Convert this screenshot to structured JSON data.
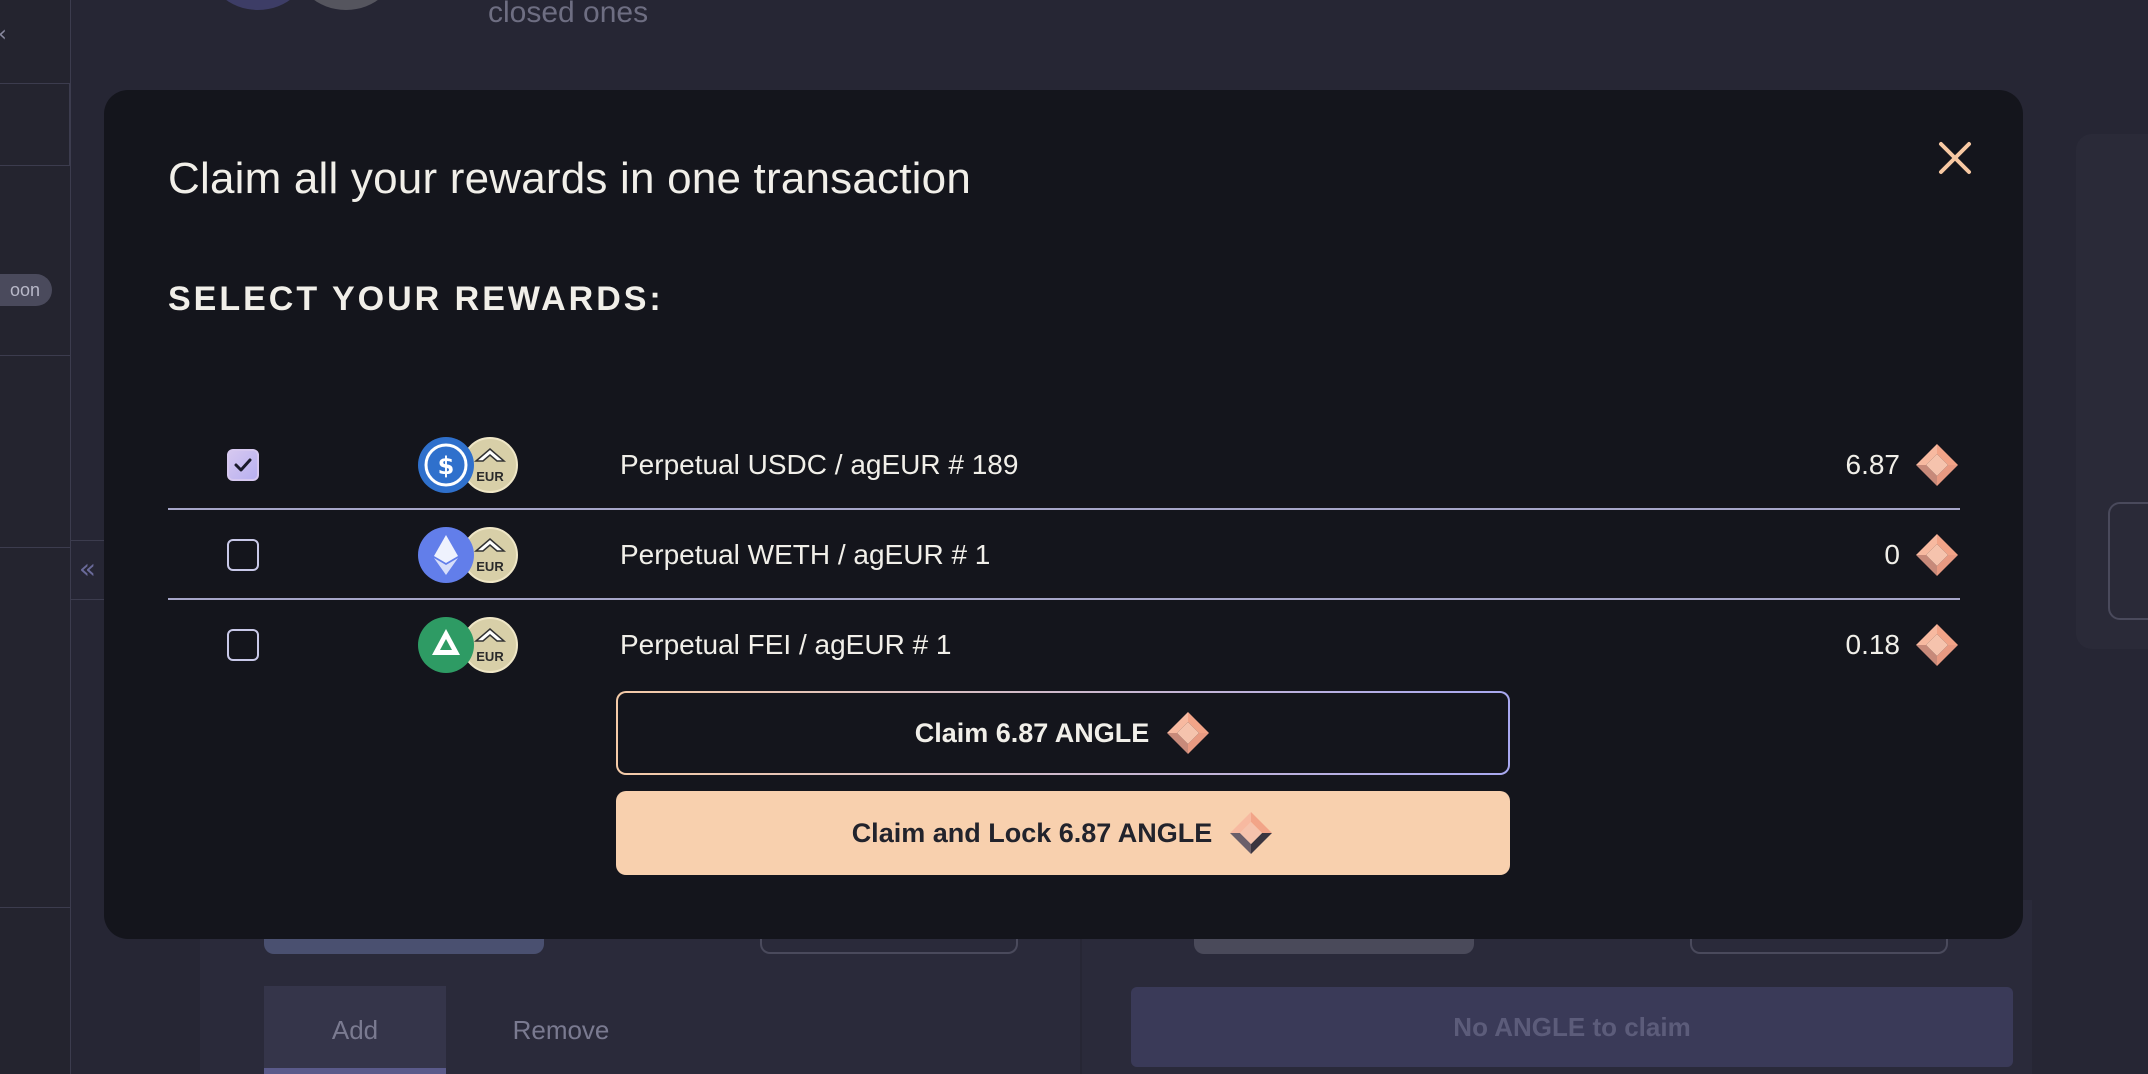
{
  "background": {
    "subtitle": "closed ones",
    "sidebar_pill": "oon",
    "tabs": [
      "Add",
      "Remove"
    ],
    "no_claim_label": "No ANGLE to claim"
  },
  "modal": {
    "title": "Claim all your rewards in one transaction",
    "section_label": "SELECT YOUR REWARDS:",
    "rewards": [
      {
        "name": "Perpetual USDC / agEUR # 189",
        "amount": "6.87",
        "checked": true,
        "token": "usdc-icon"
      },
      {
        "name": "Perpetual WETH / agEUR # 1",
        "amount": "0",
        "checked": false,
        "token": "eth-icon"
      },
      {
        "name": "Perpetual FEI / agEUR # 1",
        "amount": "0.18",
        "checked": false,
        "token": "fei-icon"
      }
    ],
    "ageur_label": "EUR",
    "claim_button": "Claim 6.87 ANGLE",
    "claim_lock_button": "Claim and Lock 6.87 ANGLE"
  },
  "colors": {
    "modal_bg": "#14151c",
    "accent_peach": "#f8d0ae",
    "accent_lavender": "#a8a8f0",
    "divider": "#a7a6c9"
  }
}
